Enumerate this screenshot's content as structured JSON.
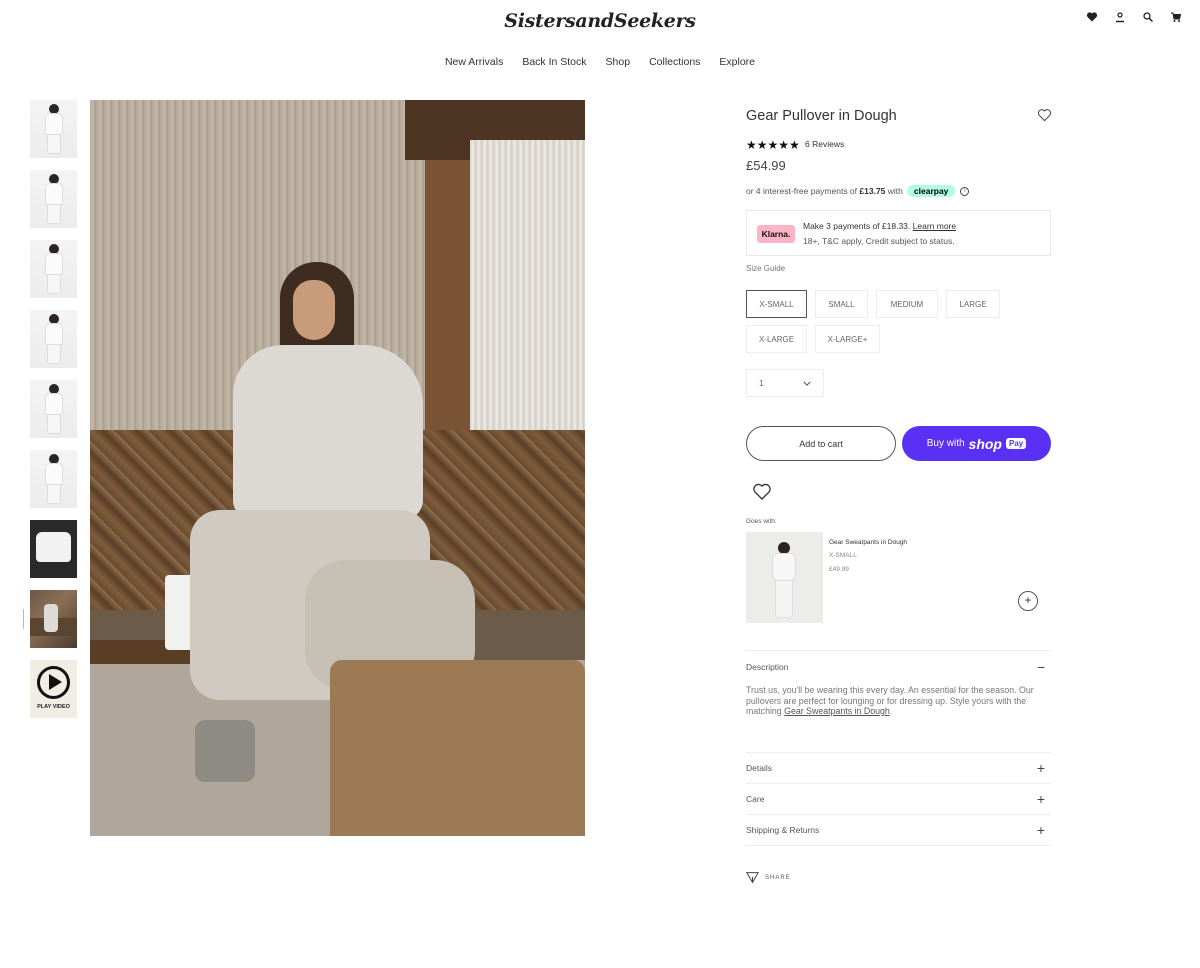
{
  "header": {
    "logo": "SistersandSeekers",
    "icons": [
      "heart-icon",
      "account-icon",
      "search-icon",
      "cart-icon"
    ]
  },
  "nav": {
    "items": [
      "New Arrivals",
      "Back In Stock",
      "Shop",
      "Collections",
      "Explore"
    ]
  },
  "gallery": {
    "play_label": "PLAY VIDEO"
  },
  "product": {
    "title": "Gear Pullover in Dough",
    "stars": "★★★★★",
    "rating": 5,
    "reviews": "6 Reviews",
    "price": "£54.99",
    "clearpay": {
      "prefix": "or 4 interest-free payments of",
      "amount": "£13.75",
      "with": "with",
      "badge": "clearpay"
    },
    "klarna": {
      "logo": "Klarna.",
      "line1": "Make 3 payments of £18.33.",
      "learn_more": "Learn more",
      "line2": "18+, T&C apply, Credit subject to status."
    },
    "size_guide": "Size Guide",
    "sizes": [
      "X-SMALL",
      "SMALL",
      "MEDIUM",
      "LARGE",
      "X-LARGE",
      "X-LARGE+"
    ],
    "selected_size": "X-SMALL",
    "quantity": "1",
    "add_to_cart": "Add to cart",
    "buy_with": "Buy with",
    "shop_label": "shop",
    "pay_label": "Pay"
  },
  "goes_with": {
    "label": "Goes with:",
    "name": "Gear Sweatpants in Dough",
    "size": "X-SMALL",
    "price": "£49.99",
    "add": "+"
  },
  "description": {
    "header": "Description",
    "sign": "−",
    "text": "Trust us, you'll be wearing this every day. An essential for the season. Our pullovers are perfect for lounging or for dressing up. Style yours with the matching",
    "link": "Gear Sweatpants in Dough",
    "end": "."
  },
  "accordion": [
    {
      "label": "Details",
      "sign": "+"
    },
    {
      "label": "Care",
      "sign": "+"
    },
    {
      "label": "Shipping & Returns",
      "sign": "+"
    }
  ],
  "share": "SHARE",
  "colors": {
    "shop_pay": "#5a31f4",
    "clearpay": "#b2fce4",
    "klarna": "#ffb3c7"
  }
}
